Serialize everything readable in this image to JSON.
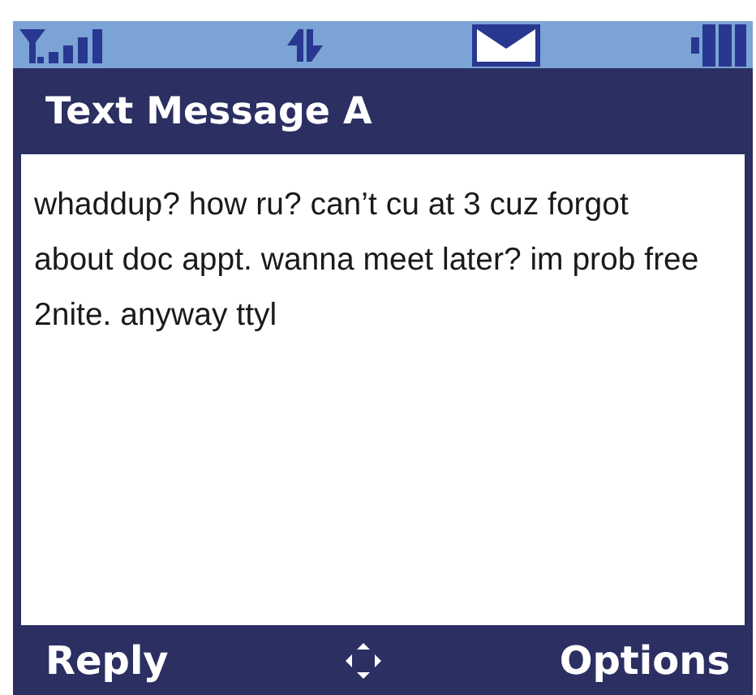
{
  "title": "Text Message A",
  "message": "whaddup? how ru? can’t cu at 3 cuz forgot about doc appt. wanna meet later? im prob free 2nite. anyway ttyl",
  "softkeys": {
    "left": "Reply",
    "right": "Options"
  }
}
